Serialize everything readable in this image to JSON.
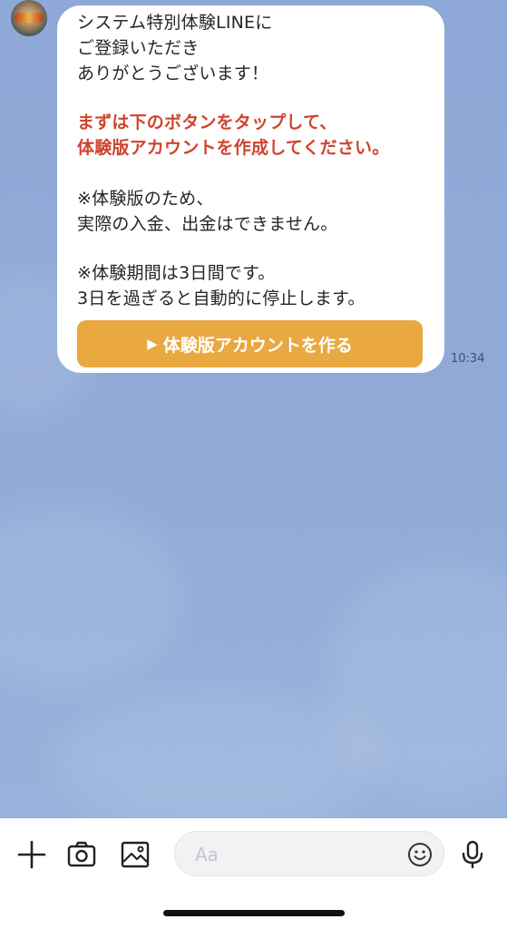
{
  "chat": {
    "message": {
      "intro_lines": [
        "システム特別体験LINEに",
        "ご登録いただき",
        "ありがとうございます！"
      ],
      "highlight_lines": [
        "まずは下のボタンをタップして、",
        "体験版アカウントを作成してください。"
      ],
      "note1_lines": [
        "※体験版のため、",
        "実際の入金、出金はできません。"
      ],
      "note2_lines": [
        "※体験期間は3日間です。",
        "3日を過ぎると自動的に停止します。"
      ],
      "button_arrow": "▶",
      "button_label": "体験版アカウントを作る",
      "timestamp": "10:34"
    }
  },
  "input_bar": {
    "placeholder": "Aa",
    "icons": [
      "plus-icon",
      "camera-icon",
      "image-icon",
      "emoji-icon",
      "microphone-icon"
    ]
  },
  "colors": {
    "chat_background": "#8fa9d6",
    "highlight_text": "#d0442d",
    "button": "#eaa840"
  }
}
